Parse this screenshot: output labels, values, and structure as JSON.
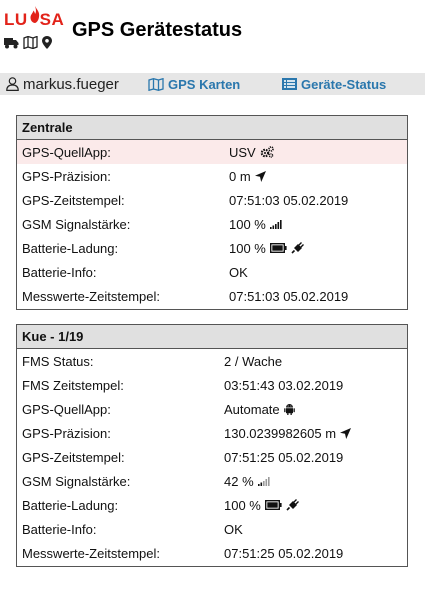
{
  "brand": {
    "logo_text_left": "LU",
    "logo_text_right": "SA",
    "accent": "#e2231a"
  },
  "page": {
    "title": "GPS Gerätestatus"
  },
  "nav": {
    "username": "markus.fueger",
    "links": [
      {
        "label": "GPS Karten",
        "icon": "map-icon"
      },
      {
        "label": "Geräte-Status",
        "icon": "list-icon"
      }
    ],
    "link_color": "#2a77ad"
  },
  "panels": [
    {
      "title": "Zentrale",
      "rows": [
        {
          "label": "GPS-QuellApp:",
          "value": "USV",
          "icon": "cogs-icon",
          "highlight": true
        },
        {
          "label": "GPS-Präzision:",
          "value": "0 m",
          "icon": "location-arrow-icon"
        },
        {
          "label": "GPS-Zeitstempel:",
          "value": "07:51:03 05.02.2019"
        },
        {
          "label": "GSM Signalstärke:",
          "value": "100 %",
          "icon": "signal-icon",
          "signal_level": 1.0
        },
        {
          "label": "Batterie-Ladung:",
          "value": "100 %",
          "icon": "battery-plug-icon",
          "battery_level": 1.0
        },
        {
          "label": "Batterie-Info:",
          "value": "OK"
        },
        {
          "label": "Messwerte-Zeitstempel:",
          "value": "07:51:03 05.02.2019"
        }
      ]
    },
    {
      "title": "Kue - 1/19",
      "rows": [
        {
          "label": "FMS Status:",
          "value": "2 / Wache"
        },
        {
          "label": "FMS Zeitstempel:",
          "value": "03:51:43 03.02.2019"
        },
        {
          "label": "GPS-QuellApp:",
          "value": "Automate",
          "icon": "android-icon"
        },
        {
          "label": "GPS-Präzision:",
          "value": "130.0239982605 m",
          "icon": "location-arrow-icon"
        },
        {
          "label": "GPS-Zeitstempel:",
          "value": "07:51:25 05.02.2019"
        },
        {
          "label": "GSM Signalstärke:",
          "value": "42 %",
          "icon": "signal-icon",
          "signal_level": 0.42
        },
        {
          "label": "Batterie-Ladung:",
          "value": "100 %",
          "icon": "battery-plug-icon",
          "battery_level": 1.0
        },
        {
          "label": "Batterie-Info:",
          "value": "OK"
        },
        {
          "label": "Messwerte-Zeitstempel:",
          "value": "07:51:25 05.02.2019"
        }
      ]
    }
  ]
}
